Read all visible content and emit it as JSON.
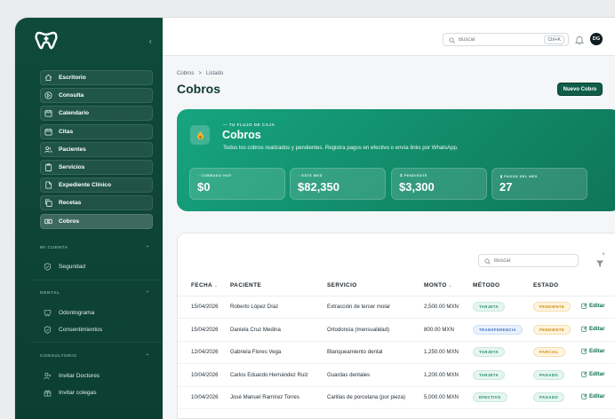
{
  "sidebar": {
    "collapse_glyph": "‹",
    "items": [
      {
        "label": "Escritorio",
        "icon": "home-icon"
      },
      {
        "label": "Consulta",
        "icon": "play-circle-icon"
      },
      {
        "label": "Calendario",
        "icon": "calendar-icon"
      },
      {
        "label": "Citas",
        "icon": "calendar-icon"
      },
      {
        "label": "Pacientes",
        "icon": "users-icon"
      },
      {
        "label": "Servicios",
        "icon": "clipboard-icon"
      },
      {
        "label": "Expediente Clínico",
        "icon": "file-icon"
      },
      {
        "label": "Recetas",
        "icon": "copy-icon"
      },
      {
        "label": "Cobros",
        "icon": "money-icon"
      }
    ],
    "sections": {
      "mi_cuenta": "MI CUENTA",
      "dental": "DENTAL",
      "consultorio": "CONSULTORIO"
    },
    "section_items": {
      "seguridad": "Seguridad",
      "odontograma": "Odontograma",
      "consentimientos": "Consentimientos",
      "invitar_doctores": "Invitar Doctores",
      "invitar_colegas": "Invitar colegas"
    }
  },
  "topbar": {
    "search_placeholder": "Buscar",
    "shortcut": "Ctrl+K",
    "avatar_initials": "DG"
  },
  "breadcrumb": {
    "parent": "Cobros",
    "separator": ">",
    "current": "Listado"
  },
  "page_title": "Cobros",
  "new_button": "Nuevo Cobro",
  "hero": {
    "kicker": "TU FLUJO DE CAJA",
    "title": "Cobros",
    "description": "Todos los cobros realizados y pendientes. Registra pagos en efectivo o envía links por WhatsApp.",
    "stats": [
      {
        "label": "COBRADO HOY",
        "value": "$0"
      },
      {
        "label": "ESTE MES",
        "value": "$82,350"
      },
      {
        "label": "PENDIENTE",
        "value": "$3,300"
      },
      {
        "label": "PAGOS DEL MES",
        "value": "27"
      }
    ]
  },
  "table": {
    "search_placeholder": "Buscar",
    "filter_count": "0",
    "columns": [
      "FECHA",
      "PACIENTE",
      "SERVICIO",
      "MONTO",
      "MÉTODO",
      "ESTADO"
    ],
    "edit_label": "Editar",
    "rows": [
      {
        "fecha": "15/04/2026",
        "paciente": "Roberto López Díaz",
        "servicio": "Extracción de tercer molar",
        "monto": "2,500.00 MXN",
        "metodo": "TARJETA",
        "estado": "PENDIENTE"
      },
      {
        "fecha": "15/04/2026",
        "paciente": "Daniela Cruz Medina",
        "servicio": "Ortodoncia (mensualidad)",
        "monto": "800.00 MXN",
        "metodo": "TRANSFERENCIA",
        "estado": "PENDIENTE"
      },
      {
        "fecha": "12/04/2026",
        "paciente": "Gabriela Flores Vega",
        "servicio": "Blanqueamiento dental",
        "monto": "1,250.00 MXN",
        "metodo": "TARJETA",
        "estado": "PARCIAL"
      },
      {
        "fecha": "10/04/2026",
        "paciente": "Carlos Eduardo Hernández Ruiz",
        "servicio": "Guardas dentales",
        "monto": "1,200.00 MXN",
        "metodo": "TARJETA",
        "estado": "PAGADO"
      },
      {
        "fecha": "10/04/2026",
        "paciente": "José Manuel Ramírez Torres",
        "servicio": "Carillas de porcelana (por pieza)",
        "monto": "5,000.00 MXN",
        "metodo": "EFECTIVO",
        "estado": "PAGADO"
      }
    ]
  },
  "colors": {
    "sidebar": "#0f4a3a",
    "brand": "#0f5c48",
    "hero": "#128d6c",
    "pending": "#c98a10",
    "paid": "#1b8c69"
  }
}
